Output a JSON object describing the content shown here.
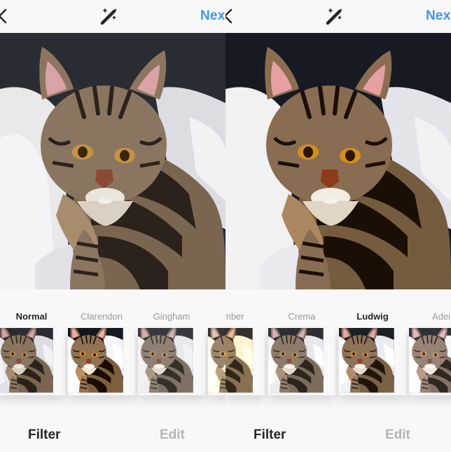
{
  "screens": [
    {
      "header": {
        "next_label": "Nex"
      },
      "filters": [
        {
          "name": "Normal",
          "active": true
        },
        {
          "name": "Clarendon",
          "active": false
        },
        {
          "name": "Gingham",
          "active": false
        }
      ],
      "tabs": {
        "filter": "Filter",
        "edit": "Edit"
      }
    },
    {
      "header": {
        "next_label": "Nex"
      },
      "filters": [
        {
          "name": "ımber",
          "active": false
        },
        {
          "name": "Crema",
          "active": false
        },
        {
          "name": "Ludwig",
          "active": true
        },
        {
          "name": "Adei",
          "active": false
        }
      ],
      "tabs": {
        "filter": "Filter",
        "edit": "Edit"
      }
    }
  ],
  "colors": {
    "accent": "#3897f0",
    "active_text": "#262626",
    "inactive_text": "#999999",
    "background": "#f8f8f8"
  },
  "icons": {
    "back": "chevron-left-icon",
    "lux": "magic-wand-icon"
  }
}
